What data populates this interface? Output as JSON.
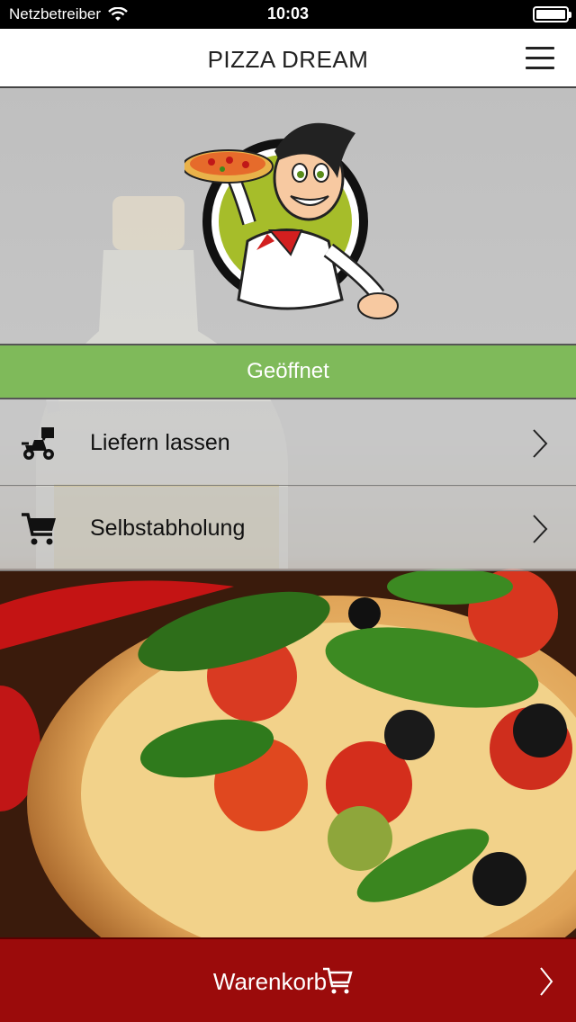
{
  "status_bar": {
    "carrier": "Netzbetreiber",
    "time": "10:03",
    "wifi_icon": "wifi-icon",
    "battery_icon": "battery-icon"
  },
  "header": {
    "title": "PIZZA DREAM",
    "menu_icon": "hamburger-menu-icon"
  },
  "hero": {
    "logo": "pizza-chef-logo"
  },
  "shop_status": {
    "label": "Geöffnet",
    "color": "#7fba5a"
  },
  "options": [
    {
      "label": "Liefern lassen",
      "icon": "delivery-scooter-icon"
    },
    {
      "label": "Selbstabholung",
      "icon": "shopping-cart-icon"
    }
  ],
  "cart": {
    "label": "Warenkorb",
    "icon": "cart-icon",
    "color": "#9b0b0b"
  }
}
